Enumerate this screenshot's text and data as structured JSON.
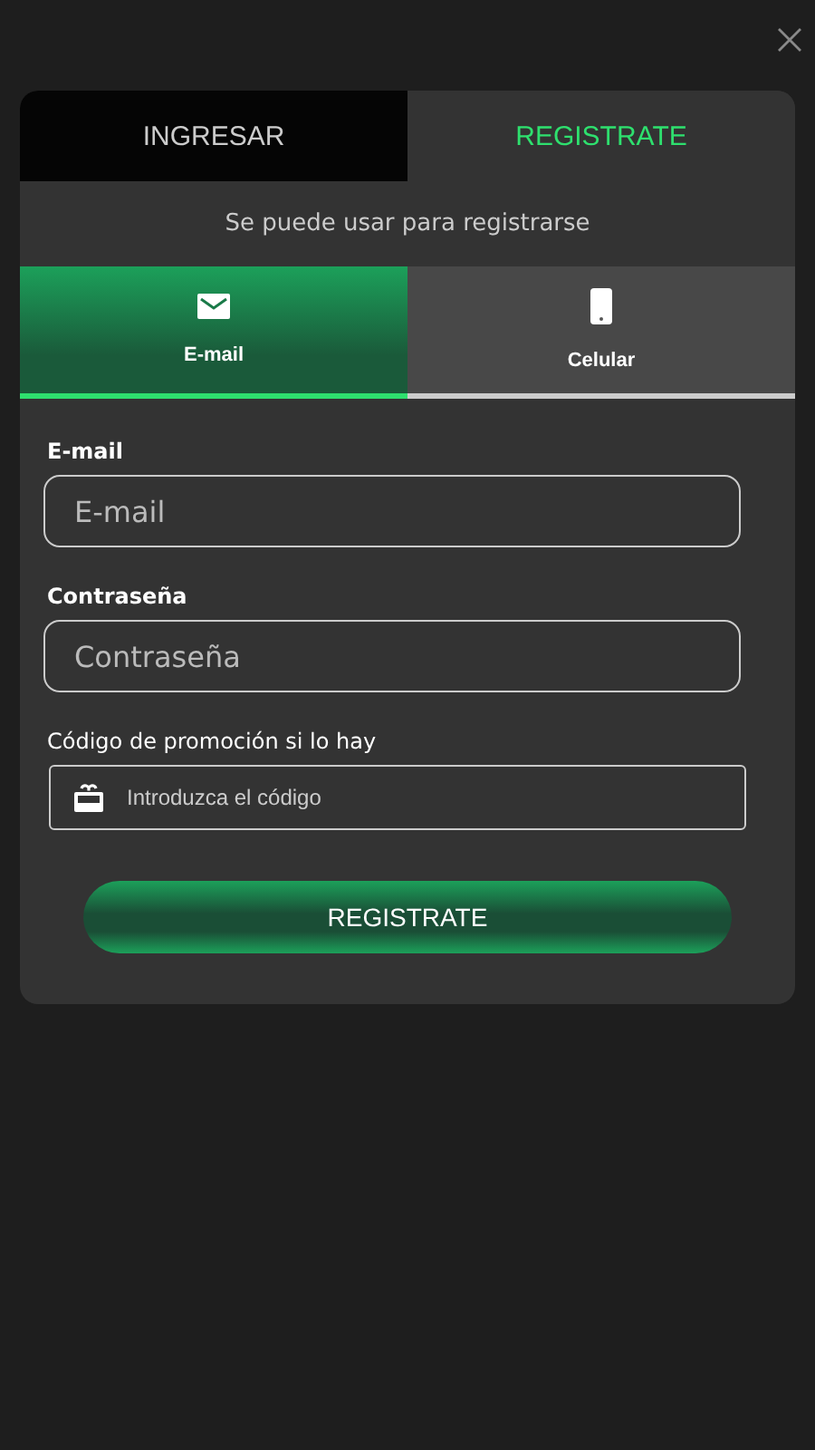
{
  "tabs": [
    {
      "label": "INGRESAR",
      "selected": false
    },
    {
      "label": "REGISTRATE",
      "selected": true
    }
  ],
  "subtitle": "Se puede usar para registrarse",
  "methods": [
    {
      "kind": "email",
      "label": "E-mail",
      "selected": true
    },
    {
      "kind": "phone",
      "label": "Celular",
      "selected": false
    }
  ],
  "fields": [
    {
      "label": "E-mail",
      "placeholder": "E-mail"
    },
    {
      "label": "Contraseña",
      "placeholder": "Contraseña"
    }
  ],
  "promo": {
    "label": "Código de promoción si lo hay",
    "placeholder": "Introduzca el código"
  },
  "submit": "REGISTRATE"
}
